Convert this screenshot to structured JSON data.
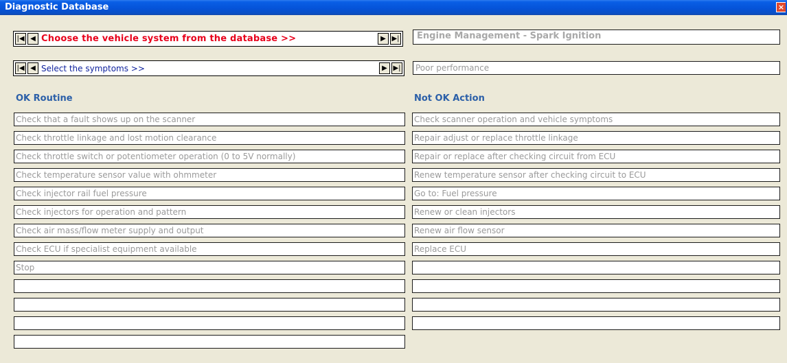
{
  "window": {
    "title": "Diagnostic Database",
    "close_icon": "close-icon"
  },
  "system_nav": {
    "label": "Choose the vehicle system from the database >>",
    "value": "Engine Management - Spark Ignition"
  },
  "symptom_nav": {
    "label": "Select the symptoms >>",
    "value": "Poor performance"
  },
  "glyphs": {
    "first": "|◀",
    "prev": "◀",
    "next": "▶",
    "last": "▶|"
  },
  "ok_routine": {
    "heading": "OK Routine",
    "items": [
      "Check that a fault shows up on the scanner",
      "Check throttle linkage and lost motion clearance",
      "Check throttle switch or potentiometer operation (0 to 5V normally)",
      "Check temperature sensor value with ohmmeter",
      "Check injector rail fuel pressure",
      "Check injectors for operation and pattern",
      "Check air mass/flow meter supply and output",
      "Check ECU if specialist equipment available",
      "Stop",
      "",
      "",
      "",
      ""
    ]
  },
  "not_ok_action": {
    "heading": "Not OK Action",
    "items": [
      "Check scanner operation and vehicle symptoms",
      "Repair adjust or replace throttle linkage",
      "Repair or replace after checking circuit from ECU",
      "Renew temperature sensor after checking circuit to ECU",
      "Go to: Fuel pressure",
      "Renew or clean injectors",
      "Renew air flow sensor",
      "Replace ECU",
      "",
      "",
      "",
      ""
    ]
  }
}
